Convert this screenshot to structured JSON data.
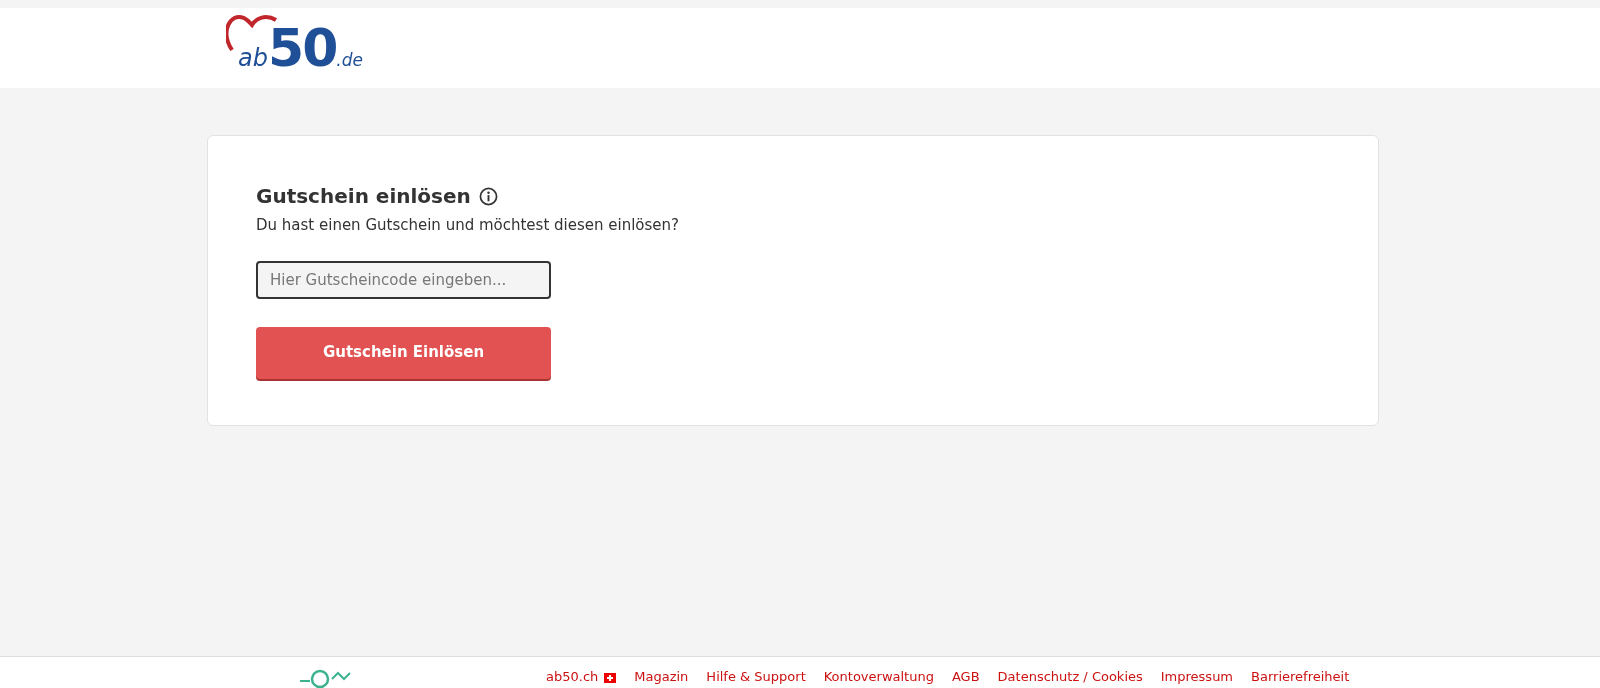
{
  "logo": {
    "prefix": "ab",
    "number": "50",
    "suffix": ".de"
  },
  "card": {
    "title": "Gutschein einlösen",
    "subtitle": "Du hast einen Gutschein und möchtest diesen einlösen?",
    "field": {
      "placeholder": "Hier Gutscheincode eingeben..."
    },
    "button": "Gutschein Einlösen"
  },
  "footer": {
    "links": [
      {
        "label": "ab50.ch",
        "flag": true
      },
      {
        "label": "Magazin",
        "flag": false
      },
      {
        "label": "Hilfe & Support",
        "flag": false
      },
      {
        "label": "Kontoverwaltung",
        "flag": false
      },
      {
        "label": "AGB",
        "flag": false
      },
      {
        "label": "Datenschutz / Cookies",
        "flag": false
      },
      {
        "label": "Impressum",
        "flag": false
      },
      {
        "label": "Barrierefreiheit",
        "flag": false
      }
    ]
  }
}
